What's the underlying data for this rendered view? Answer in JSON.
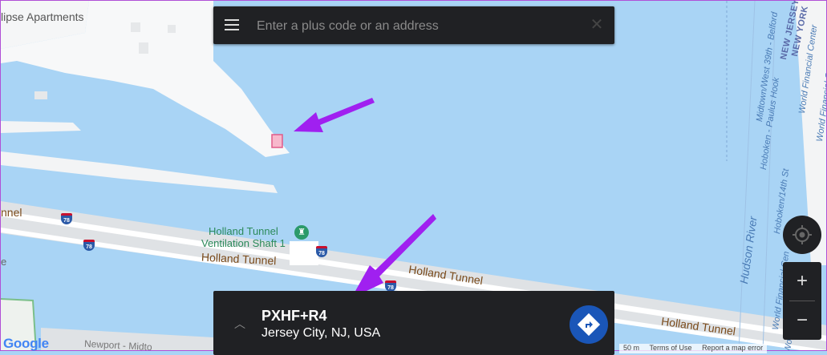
{
  "search": {
    "placeholder": "Enter a plus code or an address",
    "menu_icon": "menu-icon",
    "close_icon": "close-icon"
  },
  "map": {
    "labels": {
      "apartments": "lipse Apartments",
      "holland_tunnel_west": "nnel",
      "holland_tunnel_1": "Holland Tunnel",
      "holland_tunnel_2": "Holland Tunnel",
      "holland_tunnel_3": "Holland Tunnel",
      "ventilation_1": "Holland Tunnel",
      "ventilation_2": "Ventilation Shaft 1",
      "newport": "Newport - Midto",
      "hudson_river": "Hudson River",
      "midtown_route": "Midtown/West 39th - Belford",
      "hoboken_paulus": "Hoboken - Paulus Hook",
      "hoboken_14th": "Hoboken/14th St",
      "wfc_1": "World Financial Center",
      "wfc_2": "World Financial Center",
      "wfc_3": "World Financial Cen",
      "wfc_4": "World Financial Ce",
      "state_nj": "NEW JERSEY",
      "state_ny": "NEW YORK",
      "edge_e": "e"
    },
    "shields": [
      "78",
      "78",
      "78",
      "78"
    ]
  },
  "result": {
    "code": "PXHF+R4",
    "locality": "Jersey City, NJ, USA",
    "directions_icon": "directions-icon",
    "chevron_icon": "chevron-up-icon"
  },
  "controls": {
    "zoom_in": "+",
    "zoom_out": "−",
    "locate_icon": "my-location-icon"
  },
  "footer": {
    "google": "Google",
    "scale": "50 m",
    "terms": "Terms of Use",
    "report": "Report a map error"
  },
  "colors": {
    "water": "#a9d4f5",
    "land": "#f5f6f7",
    "panel": "#202124",
    "arrow": "#a020f0",
    "directions": "#1a56b8",
    "marker": "#e05a8a"
  }
}
